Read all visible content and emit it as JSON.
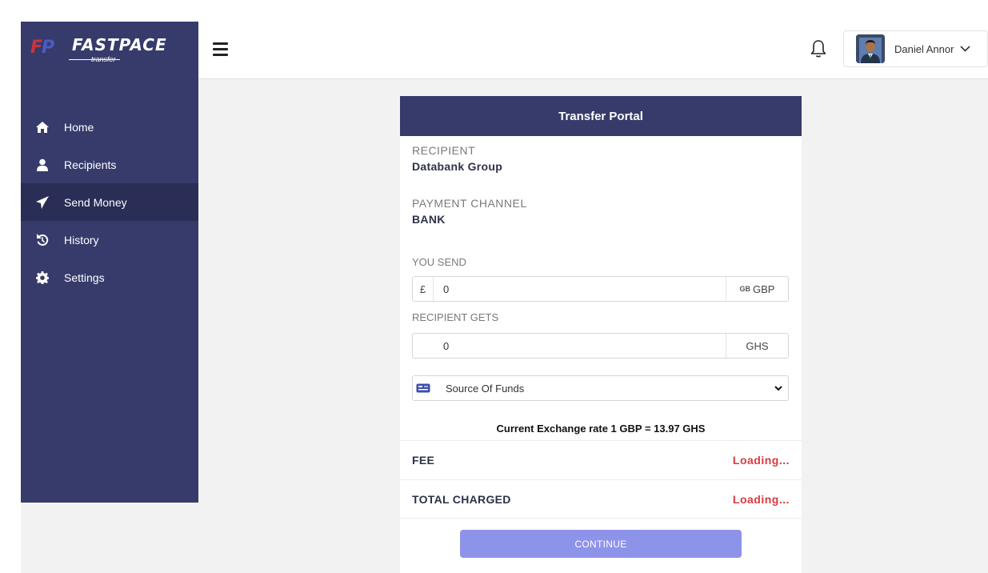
{
  "brand": {
    "mark": "FP",
    "name": "FASTPACE",
    "sub": "transfer"
  },
  "sidebar": {
    "items": [
      {
        "label": "Home",
        "icon": "home-icon"
      },
      {
        "label": "Recipients",
        "icon": "user-icon"
      },
      {
        "label": "Send Money",
        "icon": "paper-plane-icon",
        "active": true
      },
      {
        "label": "History",
        "icon": "history-icon"
      },
      {
        "label": "Settings",
        "icon": "gear-icon"
      }
    ]
  },
  "header": {
    "user_name": "Daniel Annor"
  },
  "card": {
    "title": "Transfer Portal",
    "recipient_label": "RECIPIENT",
    "recipient_value": "Databank Group",
    "channel_label": "PAYMENT CHANNEL",
    "channel_value": "BANK",
    "send_label": "YOU SEND",
    "send_prefix": "£",
    "send_value": "0",
    "send_flag": "GB",
    "send_currency": "GBP",
    "gets_label": "RECIPIENT GETS",
    "gets_value": "0",
    "gets_currency": "GHS",
    "source_label": "Source Of Funds",
    "rate_text": "Current Exchange rate 1 GBP = 13.97 GHS",
    "fee_label": "FEE",
    "fee_value": "Loading...",
    "total_label": "TOTAL CHARGED",
    "total_value": "Loading...",
    "continue_label": "CONTINUE"
  },
  "colors": {
    "sidebar": "#373b6b",
    "active": "#2a2d55",
    "button": "#8e93ea",
    "loading": "#d9393f"
  }
}
